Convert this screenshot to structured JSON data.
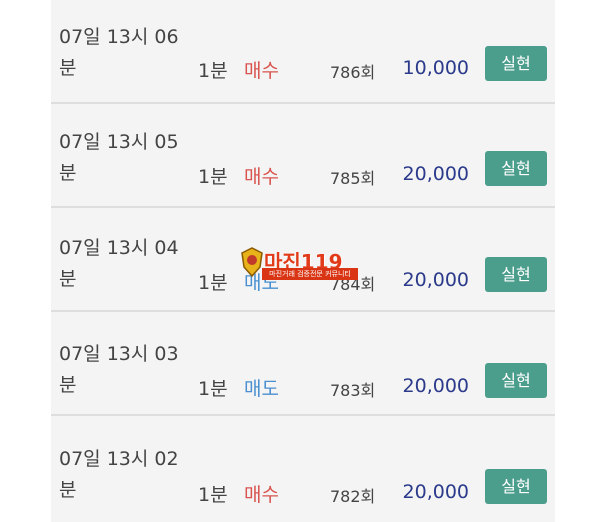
{
  "rows": [
    {
      "time": "07일 13시 06분",
      "duration": "1분",
      "side": "매수",
      "side_type": "buy",
      "round": "786회",
      "amount": "10,000",
      "action": "실현"
    },
    {
      "time": "07일 13시 05분",
      "duration": "1분",
      "side": "매수",
      "side_type": "buy",
      "round": "785회",
      "amount": "20,000",
      "action": "실현"
    },
    {
      "time": "07일 13시 04분",
      "duration": "1분",
      "side": "매도",
      "side_type": "sell",
      "round": "784회",
      "amount": "20,000",
      "action": "실현"
    },
    {
      "time": "07일 13시 03분",
      "duration": "1분",
      "side": "매도",
      "side_type": "sell",
      "round": "783회",
      "amount": "20,000",
      "action": "실현"
    },
    {
      "time": "07일 13시 02분",
      "duration": "1분",
      "side": "매수",
      "side_type": "buy",
      "round": "782회",
      "amount": "20,000",
      "action": "실현"
    }
  ],
  "watermark": {
    "title": "마진119",
    "subtitle": "마진거래 검증전문 커뮤니티"
  },
  "colors": {
    "buy": "#d9534f",
    "sell": "#4a8fd0",
    "amount": "#2b3a8a",
    "button": "#4c9e8c",
    "panel": "#f4f4f4"
  }
}
